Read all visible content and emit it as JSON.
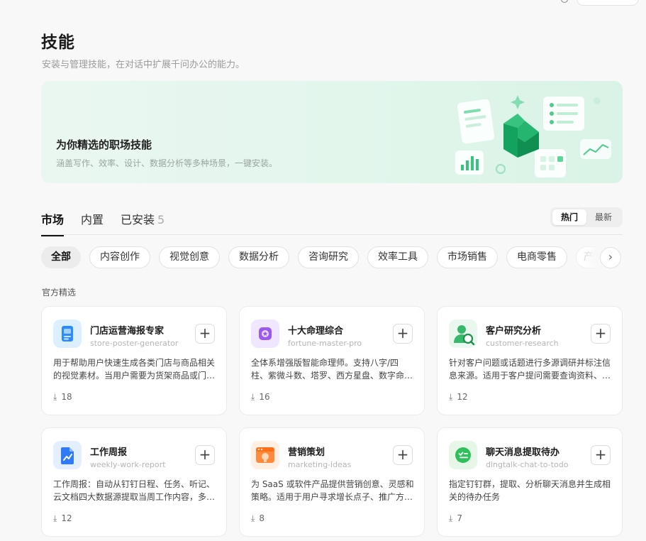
{
  "header": {
    "title": "技能",
    "subtitle": "安装与管理技能，在对话中扩展千问办公的能力。"
  },
  "banner": {
    "title": "为你精选的职场技能",
    "description": "涵盖写作、效率、设计、数据分析等多种场景，一键安装。"
  },
  "tabs": [
    {
      "label": "市场",
      "active": true
    },
    {
      "label": "内置",
      "active": false
    },
    {
      "label": "已安装",
      "count": "5",
      "active": false
    }
  ],
  "sort": {
    "hot": "热门",
    "latest": "最新"
  },
  "categories": [
    "全部",
    "内容创作",
    "视觉创意",
    "数据分析",
    "咨询研究",
    "效率工具",
    "市场销售",
    "电商零售",
    "产"
  ],
  "section_label": "官方精选",
  "cards": [
    {
      "name": "门店运营海报专家",
      "slug": "store-poster-generator",
      "description": "用于帮助用户快速生成各类门店与商品相关的视觉素材。当用户需要为货架商品或门店制作海报时使用。",
      "downloads": "18",
      "icon": "poster-icon"
    },
    {
      "name": "十大命理综合",
      "slug": "fortune-master-pro",
      "description": "全体系增强版智能命理师。支持八字/四柱、紫微斗数、塔罗、西方星盘、数字命理等。",
      "downloads": "16",
      "icon": "fortune-icon"
    },
    {
      "name": "客户研究分析",
      "slug": "customer-research",
      "description": "针对客户问题或话题进行多源调研并标注信息来源。适用于客户提问需要查询资料、整理研究报告时。",
      "downloads": "12",
      "icon": "customer-research-icon"
    },
    {
      "name": "工作周报",
      "slug": "weekly-work-report",
      "description": "工作周报：自动从钉钉日程、任务、听记、云文档四大数据源提取当周工作内容，多维度汇总生成周报。",
      "downloads": "12",
      "icon": "report-chart-icon"
    },
    {
      "name": "营销策划",
      "slug": "marketing-ideas",
      "description": "为 SaaS 或软件产品提供营销创意、灵感和策略。适用于用户寻求增长点子、推广方案时使用。",
      "downloads": "8",
      "icon": "marketing-idea-icon"
    },
    {
      "name": "聊天消息提取待办",
      "slug": "dingtalk-chat-to-todo",
      "description": "指定钉钉群，提取、分析聊天消息并生成相关的待办任务",
      "downloads": "7",
      "icon": "chat-todo-icon"
    }
  ]
}
